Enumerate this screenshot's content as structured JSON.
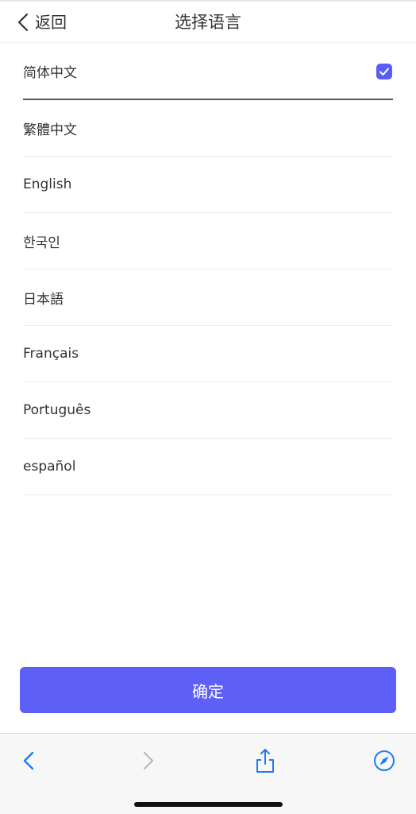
{
  "navbar": {
    "back_label": "返回",
    "title": "选择语言"
  },
  "languages": [
    {
      "label": "简体中文",
      "selected": true
    },
    {
      "label": "繁體中文",
      "selected": false
    },
    {
      "label": "English",
      "selected": false
    },
    {
      "label": "한국인",
      "selected": false
    },
    {
      "label": "日本語",
      "selected": false
    },
    {
      "label": "Français",
      "selected": false
    },
    {
      "label": "Português",
      "selected": false
    },
    {
      "label": "español",
      "selected": false
    }
  ],
  "confirm_label": "确定",
  "colors": {
    "accent": "#5d5ff7",
    "toolbar_icon": "#1a7cf5",
    "toolbar_icon_disabled": "#b9b9b9"
  },
  "icons": {
    "back": "chevron-left-icon",
    "checkbox": "checkmark-icon",
    "browser_back": "chevron-left-icon",
    "browser_forward": "chevron-right-icon",
    "share": "share-icon",
    "safari": "compass-icon"
  }
}
